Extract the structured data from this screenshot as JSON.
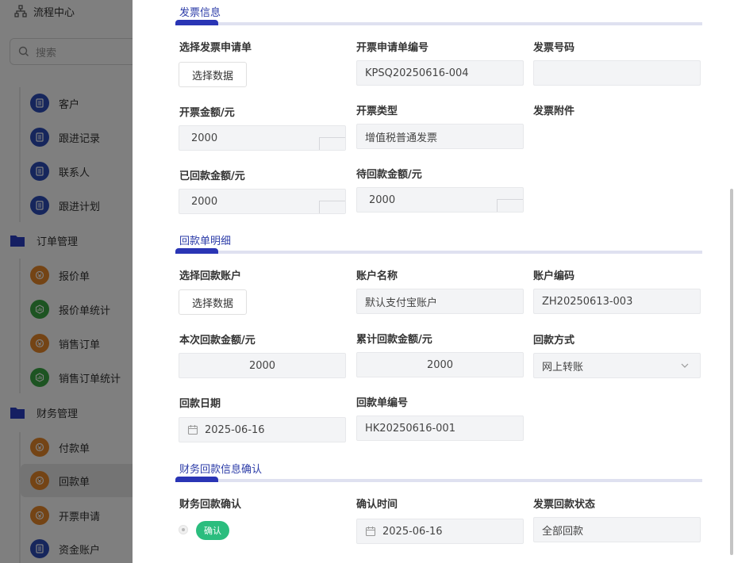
{
  "sidebar": {
    "top_label": "流程中心",
    "search_placeholder": "搜索",
    "items": [
      {
        "label": "客户",
        "icon": "doc-icon",
        "color": "#2c4db8"
      },
      {
        "label": "跟进记录",
        "icon": "doc-icon",
        "color": "#2c4db8"
      },
      {
        "label": "联系人",
        "icon": "doc-icon",
        "color": "#2c4db8"
      },
      {
        "label": "跟进计划",
        "icon": "doc-icon",
        "color": "#2c4db8"
      },
      {
        "label": "订单管理",
        "icon": "folder-icon",
        "color": "#2a3fc4"
      },
      {
        "label": "报价单",
        "icon": "money-icon",
        "color": "#e8892b"
      },
      {
        "label": "报价单统计",
        "icon": "chart-icon",
        "color": "#3aa845"
      },
      {
        "label": "销售订单",
        "icon": "money-icon",
        "color": "#e8892b"
      },
      {
        "label": "销售订单统计",
        "icon": "chart-icon",
        "color": "#3aa845"
      },
      {
        "label": "财务管理",
        "icon": "folder-icon",
        "color": "#2a3fc4"
      },
      {
        "label": "付款单",
        "icon": "money-icon",
        "color": "#e8892b"
      },
      {
        "label": "回款单",
        "icon": "money-icon",
        "color": "#e8892b"
      },
      {
        "label": "开票申请",
        "icon": "money-icon",
        "color": "#e8892b"
      },
      {
        "label": "资金账户",
        "icon": "doc-icon",
        "color": "#2c4db8"
      }
    ]
  },
  "invoice": {
    "title": "发票信息",
    "select_request_label": "选择发票申请单",
    "select_button": "选择数据",
    "request_no_label": "开票申请单编号",
    "request_no_value": "KPSQ20250616-004",
    "invoice_no_label": "发票号码",
    "invoice_no_value": "",
    "amount_label": "开票金额/元",
    "amount_value": "2000",
    "type_label": "开票类型",
    "type_value": "增值税普通发票",
    "attachment_label": "发票附件",
    "received_label": "已回款金额/元",
    "received_value": "2000",
    "pending_label": "待回款金额/元",
    "pending_value": "2000"
  },
  "payment_detail": {
    "title": "回款单明细",
    "select_account_label": "选择回款账户",
    "select_button": "选择数据",
    "account_name_label": "账户名称",
    "account_name_value": "默认支付宝账户",
    "account_code_label": "账户编码",
    "account_code_value": "ZH20250613-003",
    "current_amount_label": "本次回款金额/元",
    "current_amount_value": "2000",
    "total_amount_label": "累计回款金额/元",
    "total_amount_value": "2000",
    "method_label": "回款方式",
    "method_value": "网上转账",
    "date_label": "回款日期",
    "date_value": "2025-06-16",
    "payment_no_label": "回款单编号",
    "payment_no_value": "HK20250616-001"
  },
  "finance_confirm": {
    "title": "财务回款信息确认",
    "confirm_label": "财务回款确认",
    "confirm_badge": "确认",
    "confirm_time_label": "确认时间",
    "confirm_time_value": "2025-06-16",
    "status_label": "发票回款状态",
    "status_value": "全部回款"
  },
  "colors": {
    "accent": "#2a35b5",
    "section_title": "#2c3ca8",
    "confirm_badge": "#2bbd7e"
  }
}
